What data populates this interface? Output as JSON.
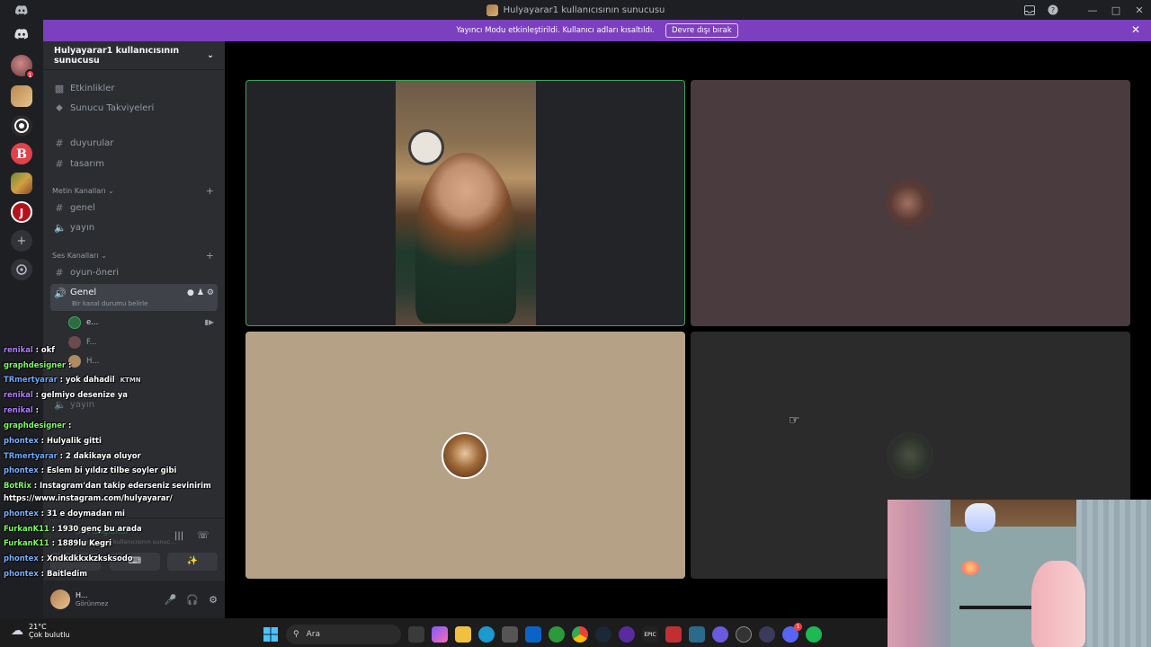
{
  "window": {
    "title": "Hulyayarar1 kullanıcısının sunucusu"
  },
  "banner": {
    "text": "Yayıncı Modu etkinleştirildi. Kullanıcı adları kısaltıldı.",
    "button": "Devre dışı bırak"
  },
  "rail": {
    "badge": "1"
  },
  "sidebar": {
    "server_name": "Hulyayarar1 kullanıcısının sunucusu",
    "top_items": [
      "Etkinlikler",
      "Sunucu Takviyeleri"
    ],
    "channels_loose": [
      "duyurular",
      "tasarım"
    ],
    "text_category": "Metin Kanalları",
    "text_channels": [
      "genel",
      "yayın"
    ],
    "voice_category": "Ses Kanalları",
    "voice_channels_top": [
      "oyun-öneri"
    ],
    "active_voice": {
      "name": "Genel",
      "status": "Bir kanal durumu belirle"
    },
    "voice_members": [
      "e...",
      "F...",
      "H..."
    ],
    "voice_channels_bottom": [
      "yayın"
    ],
    "voice_connected": {
      "status": "Ses Bağlandı",
      "server": "Hulyayarar1 kullanıcısının sunuc..."
    },
    "user": {
      "name": "H...",
      "status": "Görünmez"
    }
  },
  "chat": [
    {
      "user": "renikal",
      "text": " : okf",
      "color": "#b07cff"
    },
    {
      "user": "graphdesigner",
      "text": " :",
      "color": "#7cfc5c"
    },
    {
      "user": "TRmertyarar",
      "text": " : yok dahadil",
      "color": "#6aa8ff",
      "badge": "KTMN"
    },
    {
      "user": "renikal",
      "text": " : gelmiyo desenize ya",
      "color": "#b07cff"
    },
    {
      "user": "renikal",
      "text": " :",
      "color": "#b07cff"
    },
    {
      "user": "graphdesigner",
      "text": " :",
      "color": "#7cfc5c"
    },
    {
      "user": "phontex",
      "text": " : Hulyalik gitti",
      "color": "#7ab0ff"
    },
    {
      "user": "TRmertyarar",
      "text": " : 2 dakikaya oluyor",
      "color": "#6aa8ff"
    },
    {
      "user": "phontex",
      "text": " : Eslem bi yıldız tilbe soyler gibi",
      "color": "#7ab0ff"
    },
    {
      "user": "BotRix",
      "text": " : Instagram'dan takip ederseniz sevinirim",
      "color": "#7cfc5c"
    },
    {
      "user": "",
      "text": "https://www.instagram.com/hulyayarar/",
      "color": "#ffffff"
    },
    {
      "user": "phontex",
      "text": " : 31 e doymadan mi",
      "color": "#7ab0ff"
    },
    {
      "user": "FurkanK11",
      "text": " : 1930 genç bu arada",
      "color": "#7cfc5c"
    },
    {
      "user": "FurkanK11",
      "text": " : 1889lu Kegri",
      "color": "#7cfc5c"
    },
    {
      "user": "phontex",
      "text": " : Xndkdkkxkzksksodo",
      "color": "#7ab0ff"
    },
    {
      "user": "phontex",
      "text": " : Baitledim",
      "color": "#7ab0ff"
    }
  ],
  "taskbar": {
    "weather_temp": "21°C",
    "weather_desc": "Çok bulutlu",
    "search_placeholder": "Ara",
    "discord_badge": "1"
  },
  "colors": {
    "accent": "#7b3fbf",
    "tile_speaking_border": "#3ba55d",
    "tile2": "#4a3b3f",
    "tile3": "#b5a286",
    "tile4": "#2b2b2b"
  }
}
